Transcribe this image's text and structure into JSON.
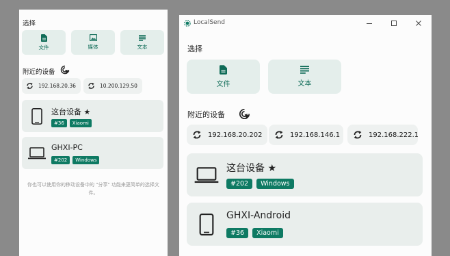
{
  "mobile": {
    "select_title": "选择",
    "select_buttons": [
      {
        "label": "文件",
        "icon": "file-icon"
      },
      {
        "label": "媒体",
        "icon": "image-icon"
      },
      {
        "label": "文本",
        "icon": "text-icon"
      }
    ],
    "nearby_title": "附近的设备",
    "ip_buttons": [
      "192.168.20.36",
      "10.200.129.50"
    ],
    "devices": [
      {
        "name": "这台设备 ★",
        "tags": [
          "#36",
          "Xiaomi"
        ],
        "icon": "phone-icon"
      },
      {
        "name": "GHXI-PC",
        "tags": [
          "#202",
          "Windows"
        ],
        "icon": "laptop-icon"
      }
    ],
    "hint": "你也可以使用你的移动设备中的 \"分享\" 功能来更简单的选择文件。"
  },
  "window": {
    "title": "LocalSend",
    "select_title": "选择",
    "select_buttons": [
      {
        "label": "文件",
        "icon": "file-icon"
      },
      {
        "label": "文本",
        "icon": "text-icon"
      }
    ],
    "nearby_title": "附近的设备",
    "ip_buttons": [
      "192.168.20.202",
      "192.168.146.1",
      "192.168.222.1"
    ],
    "devices": [
      {
        "name": "这台设备 ★",
        "tags": [
          "#202",
          "Windows"
        ],
        "icon": "laptop-icon"
      },
      {
        "name": "GHXI-Android",
        "tags": [
          "#36",
          "Xiaomi"
        ],
        "icon": "phone-icon"
      }
    ]
  },
  "colors": {
    "accent": "#0e7a63",
    "button_bg": "#e4eeeb",
    "card_bg": "#e9eeec",
    "desktop_bg": "#8a8a8a"
  }
}
